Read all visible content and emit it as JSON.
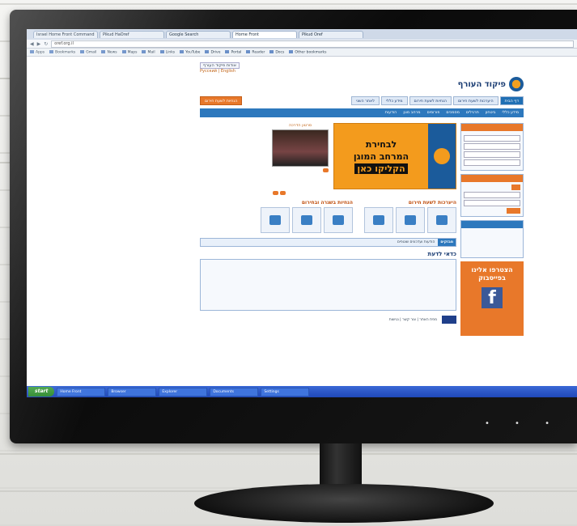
{
  "browser": {
    "tabs": [
      "Israel Home Front Command",
      "Pikud HaOref",
      "Google Search",
      "Home Front",
      "Pikud Oref"
    ],
    "url": "oref.org.il",
    "bookmarks": [
      "Apps",
      "Bookmarks",
      "Gmail",
      "News",
      "Maps",
      "Mail",
      "Links",
      "YouTube",
      "Drive",
      "Portal",
      "Reader",
      "Docs",
      "Other bookmarks"
    ]
  },
  "site": {
    "top_links": "אודות פיקוד העורף",
    "langs": "Русский | English",
    "logo_text": "פיקוד העורף",
    "menu1": [
      "דף הבית",
      "היערכות לשעת חירום",
      "הנחיות לשעת חירום",
      "מידע כללי",
      "לאתר השני"
    ],
    "menu1_orange": "הנחיות לשעת חירום",
    "menu2": [
      "מידע כללי",
      "ביטחון",
      "תרגילים",
      "מסמכים",
      "פורומים",
      "מרחב מוגן",
      "הודעות"
    ],
    "banner_lines": [
      "לבחירת",
      "המרחב המוגן",
      "הקליקו כאן"
    ],
    "video_title": "סרטון הדרכה",
    "section1_title": "היערכות לשעת חירום",
    "section2_title": "הנחיות בשגרה ובחירום",
    "ready_title": "כדאי לדעת",
    "facebook_line1": "הצטרפו אלינו",
    "facebook_line2": "בפייסבוק",
    "facebook_letter": "f",
    "ticker_label": "מבזקים",
    "ticker_text": "הודעות ועדכונים שוטפים",
    "footer": "מפת האתר | צור קשר | נגישות"
  },
  "taskbar": {
    "start": "start",
    "items": [
      "Home Front",
      "Browser",
      "Explorer",
      "Documents",
      "Settings"
    ]
  }
}
